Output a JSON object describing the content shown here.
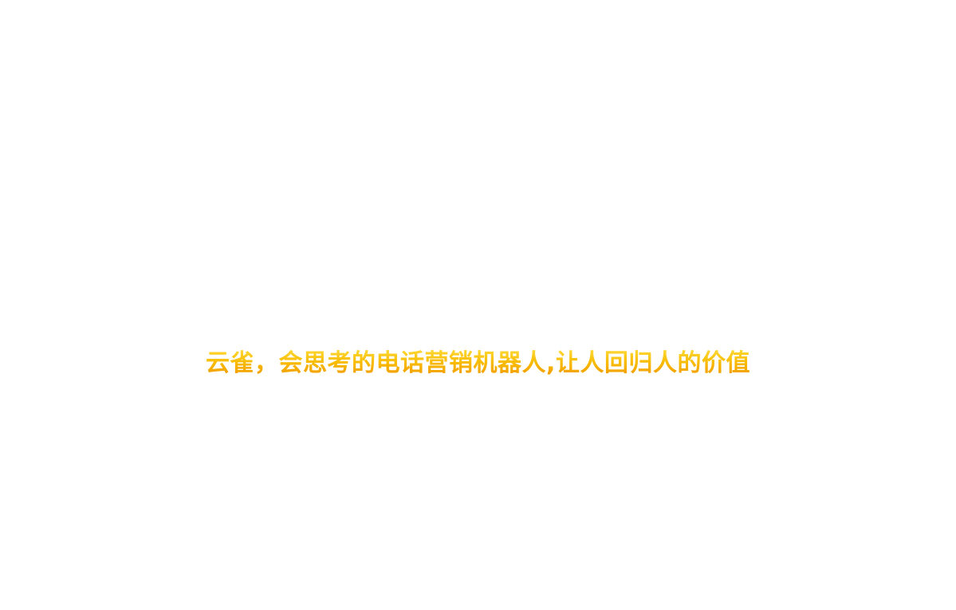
{
  "hero": {
    "tagline": "云雀，会思考的电话营销机器人,让人回归人的价值",
    "description": "",
    "colors": {
      "background": "#ffffff",
      "tagline_gradient_top": "#ffe14a",
      "tagline_gradient_mid": "#f7b800",
      "tagline_gradient_bottom": "#ef8a00"
    }
  }
}
